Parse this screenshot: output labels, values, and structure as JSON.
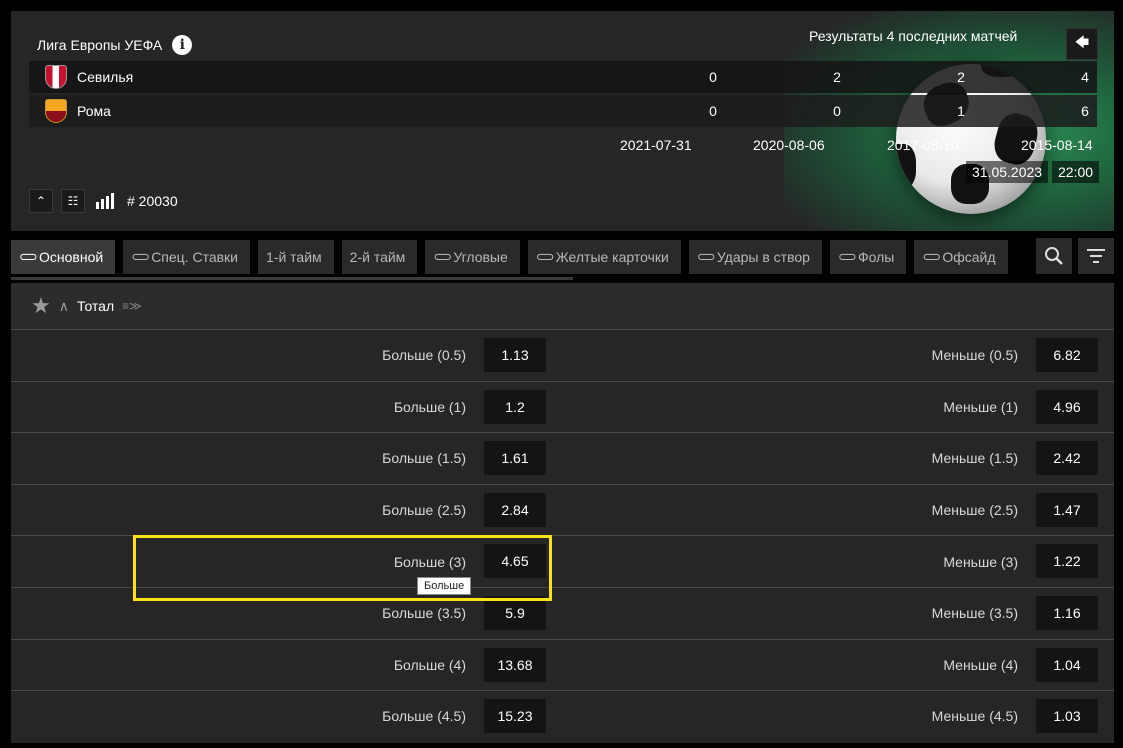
{
  "header": {
    "league": "Лига Европы УЕФА",
    "results_title": "Результаты 4 последних матчей",
    "teams": [
      {
        "name": "Севилья",
        "scores": [
          "0",
          "2",
          "2",
          "4"
        ]
      },
      {
        "name": "Рома",
        "scores": [
          "0",
          "0",
          "1",
          "6"
        ]
      }
    ],
    "dates": [
      "2021-07-31",
      "2020-08-06",
      "2017-08-10",
      "2015-08-14"
    ],
    "match_date": "31.05.2023",
    "match_time": "22:00",
    "match_id": "# 20030"
  },
  "tabs": [
    {
      "label": "Основной",
      "linked": true,
      "active": true
    },
    {
      "label": "Спец. Ставки",
      "linked": true
    },
    {
      "label": "1-й тайм",
      "linked": false
    },
    {
      "label": "2-й тайм",
      "linked": false
    },
    {
      "label": "Угловые",
      "linked": true
    },
    {
      "label": "Желтые карточки",
      "linked": true
    },
    {
      "label": "Удары в створ",
      "linked": true
    },
    {
      "label": "Фолы",
      "linked": true
    },
    {
      "label": "Офсайд",
      "linked": true
    }
  ],
  "market": {
    "title": "Тотал",
    "rows": [
      {
        "over_label": "Больше (0.5)",
        "over_odd": "1.13",
        "under_label": "Меньше (0.5)",
        "under_odd": "6.82"
      },
      {
        "over_label": "Больше (1)",
        "over_odd": "1.2",
        "under_label": "Меньше (1)",
        "under_odd": "4.96"
      },
      {
        "over_label": "Больше (1.5)",
        "over_odd": "1.61",
        "under_label": "Меньше (1.5)",
        "under_odd": "2.42"
      },
      {
        "over_label": "Больше (2.5)",
        "over_odd": "2.84",
        "under_label": "Меньше (2.5)",
        "under_odd": "1.47"
      },
      {
        "over_label": "Больше (3)",
        "over_odd": "4.65",
        "under_label": "Меньше (3)",
        "under_odd": "1.22"
      },
      {
        "over_label": "Больше (3.5)",
        "over_odd": "5.9",
        "under_label": "Меньше (3.5)",
        "under_odd": "1.16"
      },
      {
        "over_label": "Больше (4)",
        "over_odd": "13.68",
        "under_label": "Меньше (4)",
        "under_odd": "1.04"
      },
      {
        "over_label": "Больше (4.5)",
        "over_odd": "15.23",
        "under_label": "Меньше (4.5)",
        "under_odd": "1.03"
      }
    ]
  },
  "tooltip": "Больше",
  "colors": {
    "highlight": "#f7e316",
    "panel": "#262626",
    "odd_bg": "#141414"
  }
}
